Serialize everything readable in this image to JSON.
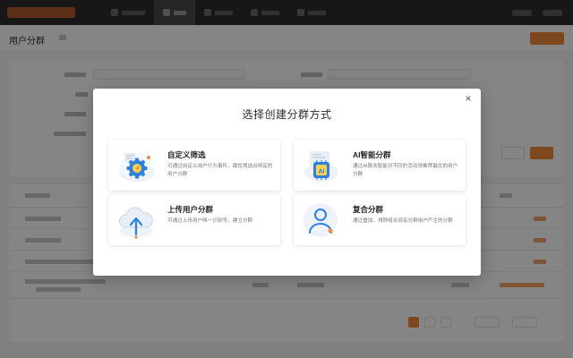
{
  "background": {
    "page_title": "用户分群"
  },
  "modal": {
    "title": "选择创建分群方式",
    "close_label": "×",
    "options": [
      {
        "title": "自定义筛选",
        "desc": "可通过自定义用户行为事件，属性筛选出特定的用户分群",
        "icon": "gear-cloud-icon"
      },
      {
        "title": "AI智能分群",
        "desc": "通过AI算法智能对不同的活动须推荐最优的用户分群",
        "icon": "ai-chip-icon"
      },
      {
        "title": "上传用户分群",
        "desc": "可通过上传用户唯一识别号，建立分群",
        "icon": "upload-cloud-icon"
      },
      {
        "title": "复合分群",
        "desc": "通过叠加、排除组合现有分群用户产生的分群",
        "icon": "user-group-icon"
      }
    ]
  },
  "colors": {
    "accent": "#f28a3c",
    "icon_blue": "#2f80e0"
  }
}
